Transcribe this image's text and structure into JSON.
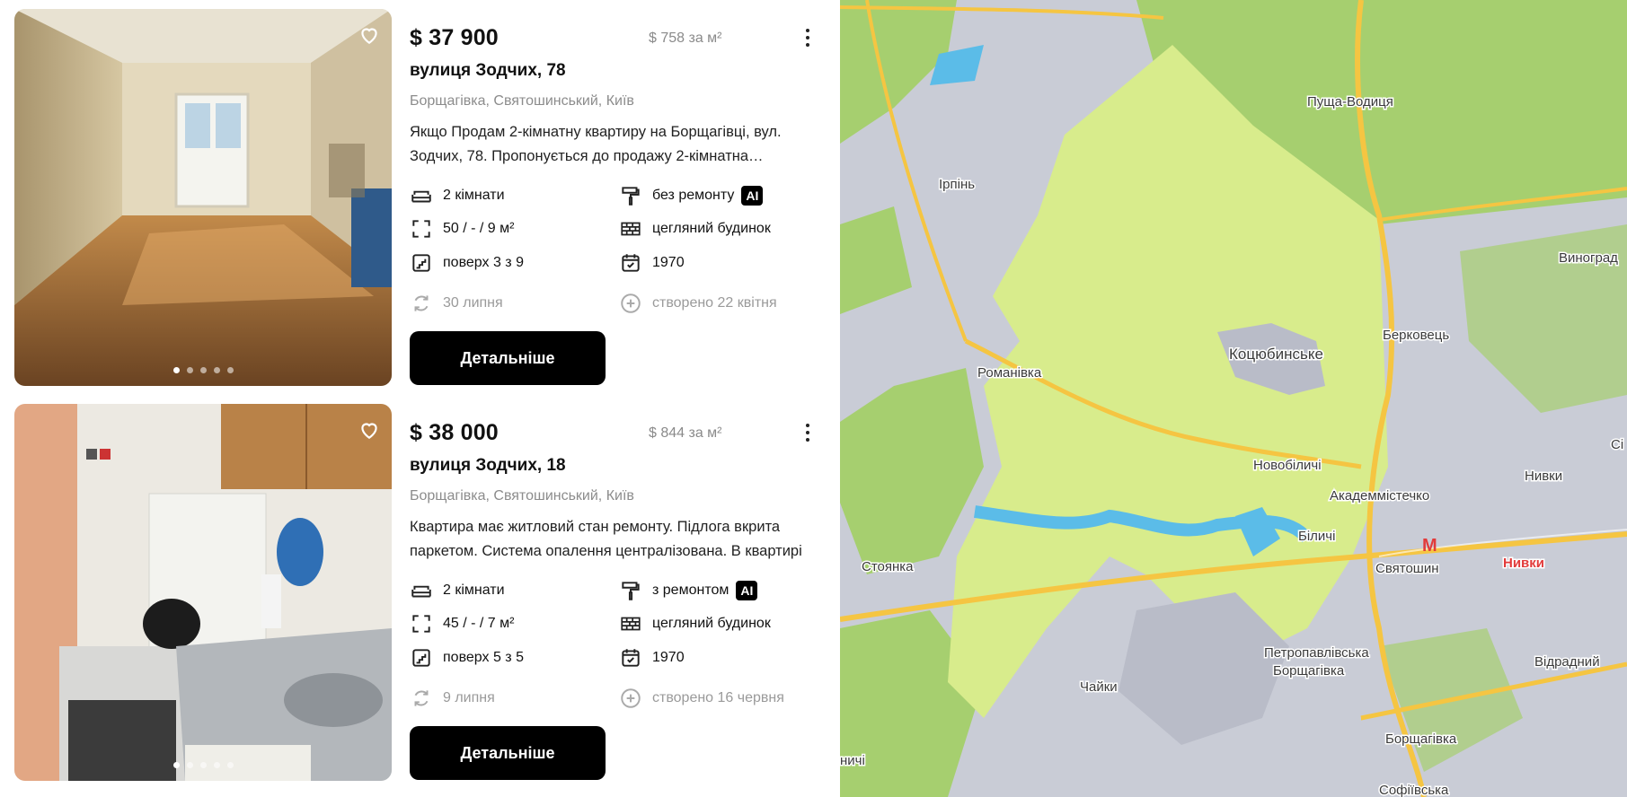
{
  "listings": [
    {
      "price": "$ 37 900",
      "price_per_m2": "$ 758 за м²",
      "street": "вулиця Зодчих, 78",
      "district": "Борщагівка, Святошинський, Київ",
      "description": "Якщо Продам 2-кімнатну квартиру на Борщагівці, вул. Зодчих, 78. Пропонується до продажу 2-кімнатна квартира",
      "rooms": "2 кімнати",
      "renovation": "без ремонту",
      "ai_badge": "AI",
      "area": "50 / - / 9 м²",
      "building": "цегляний будинок",
      "floor": "поверх 3 з 9",
      "year": "1970",
      "updated": "30 липня",
      "created": "створено 22 квітня",
      "button": "Детальніше",
      "slide_count": 5,
      "active_slide": 1
    },
    {
      "price": "$ 38 000",
      "price_per_m2": "$ 844 за м²",
      "street": "вулиця Зодчих, 18",
      "district": "Борщагівка, Святошинський, Київ",
      "description": "Квартира має житловий стан ремонту. Підлога вкрита паркетом. Система опалення централізована. В квартирі",
      "rooms": "2 кімнати",
      "renovation": "з ремонтом",
      "ai_badge": "AI",
      "area": "45 / - / 7 м²",
      "building": "цегляний будинок",
      "floor": "поверх 5 з 5",
      "year": "1970",
      "updated": "9 липня",
      "created": "створено 16 червня",
      "button": "Детальніше",
      "slide_count": 5,
      "active_slide": 1
    }
  ],
  "map": {
    "labels": {
      "pushcha": "Пуща-Водиця",
      "irpin": "Ірпінь",
      "vynohrad": "Виноград",
      "berkovets": "Берковець",
      "kotsiubynske": "Коцюбинське",
      "romanivka": "Романівка",
      "novobilychi": "Новобіличі",
      "akademmistechko": "Академмістечко",
      "nyvky": "Нивки",
      "bilychi": "Біличі",
      "stoianka": "Стоянка",
      "sviatoshyn": "Святошин",
      "metro_nyvky": "Нивки",
      "metro_icon": "М",
      "petropavlivska_1": "Петропавлівська",
      "petropavlivska_2": "Борщагівка",
      "vidradnyi": "Відрадний",
      "chaiky": "Чайки",
      "borshchahivka": "Борщагівка",
      "sofiivska": "Софіївська",
      "nychi": "ничі",
      "si": "Сі"
    },
    "colors": {
      "urban": "#c9ccd6",
      "forest": "#a6cf6f",
      "open_land": "#d8ec8c",
      "water": "#5bbce8",
      "road": "#f5c542",
      "metro": "#e23b3b"
    }
  }
}
